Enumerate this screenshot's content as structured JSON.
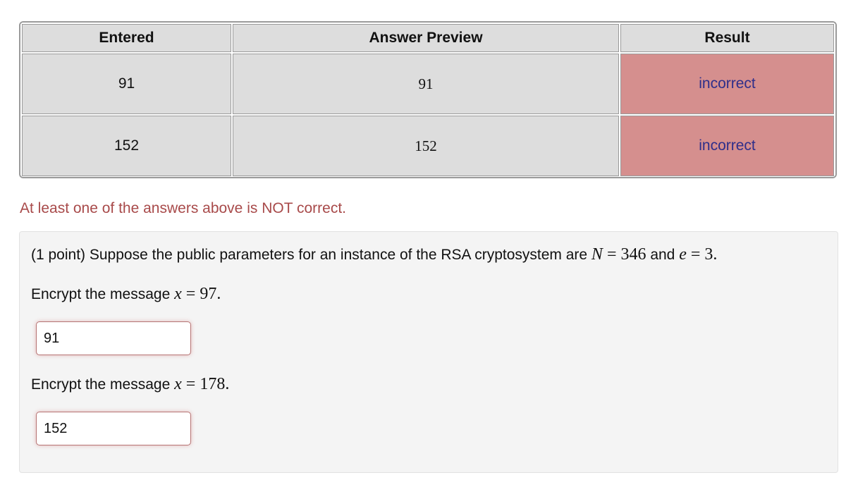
{
  "results_table": {
    "headers": [
      "Entered",
      "Answer Preview",
      "Result"
    ],
    "rows": [
      {
        "entered": "91",
        "preview": "91",
        "result": "incorrect"
      },
      {
        "entered": "152",
        "preview": "152",
        "result": "incorrect"
      }
    ],
    "colors": {
      "incorrect_bg": "#d58f8e",
      "incorrect_text": "#2e2e8a"
    }
  },
  "status_message": "At least one of the answers above is NOT correct.",
  "problem": {
    "intro_prefix": "(1 point) Suppose the public parameters for an instance of the RSA cryptosystem are ",
    "N_var": "N",
    "N_value": "346",
    "and_text": " and ",
    "e_var": "e",
    "e_value": "3",
    "questions": [
      {
        "prefix": "Encrypt the message ",
        "var": "x",
        "value": "97",
        "answer": "91"
      },
      {
        "prefix": "Encrypt the message ",
        "var": "x",
        "value": "178",
        "answer": "152"
      }
    ]
  }
}
